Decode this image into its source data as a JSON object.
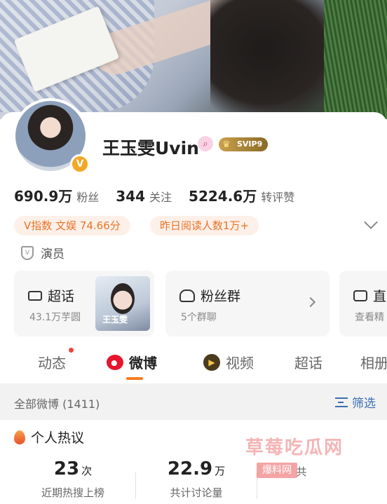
{
  "profile": {
    "name": "王玉雯Uvin",
    "svip_label": "SVIP9",
    "verified_badge": "V",
    "followers_num": "690.9万",
    "followers_lbl": "粉丝",
    "following_num": "344",
    "following_lbl": "关注",
    "likes_num": "5224.6万",
    "likes_lbl": "转评赞",
    "tags": [
      "V指数 文娱 74.66分",
      "昨日阅读人数1万+"
    ],
    "role": "演员"
  },
  "modules": [
    {
      "title": "超话",
      "sub": "43.1万芋圆",
      "thumb_caption": "王玉雯"
    },
    {
      "title": "粉丝群",
      "sub": "5个群聊"
    },
    {
      "title": "直",
      "sub": "查看精"
    }
  ],
  "tabs": [
    {
      "label": "动态",
      "has_dot": true
    },
    {
      "label": "微博",
      "active": true
    },
    {
      "label": "视频"
    },
    {
      "label": "超话"
    },
    {
      "label": "相册"
    }
  ],
  "filter": {
    "title": "全部微博 (1411)",
    "button": "筛选"
  },
  "hot": {
    "title": "个人热议",
    "metrics": [
      {
        "value": "23",
        "unit": "次",
        "label": "近期热搜上榜"
      },
      {
        "value": "22.9",
        "unit": "万",
        "label": "共计讨论量"
      },
      {
        "value": "",
        "unit": "",
        "label": "共"
      }
    ]
  },
  "watermark": {
    "text": "草莓吃瓜网",
    "sub": "爆料网"
  },
  "colors": {
    "accent": "#f57c1f",
    "tag_text": "#e8742a",
    "tag_bg": "#fdf0e8",
    "link": "#3a6fb0"
  }
}
